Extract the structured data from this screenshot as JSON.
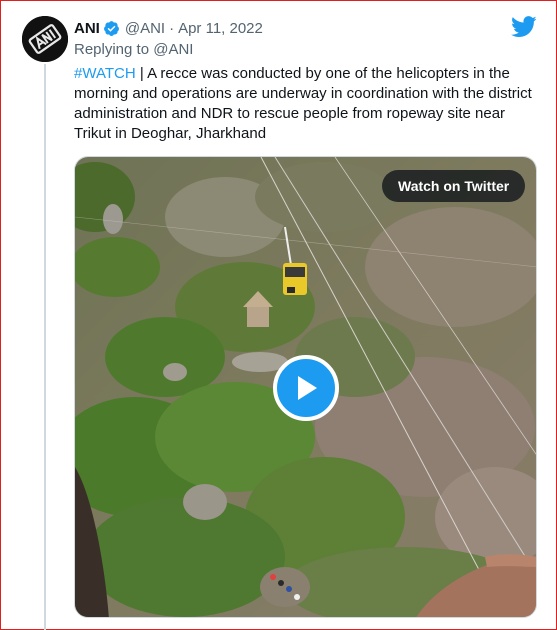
{
  "tweet": {
    "author_name": "ANI",
    "handle": "@ANI",
    "separator": "·",
    "date": "Apr 11, 2022",
    "reply_prefix": "Replying to",
    "reply_handle": "@ANI",
    "hashtag": "#WATCH",
    "text": " | A recce was conducted by one of the helicopters in the morning and operations are underway in coordination with the district administration and NDR to rescue people from ropeway site near Trikut in Deoghar, Jharkhand"
  },
  "media": {
    "watch_label": "Watch on Twitter"
  },
  "icons": {
    "verified": "verified-badge-icon",
    "logo": "twitter-bird-icon",
    "play": "play-icon"
  },
  "colors": {
    "accent": "#1d9bf0",
    "frame_border": "#e02020"
  }
}
